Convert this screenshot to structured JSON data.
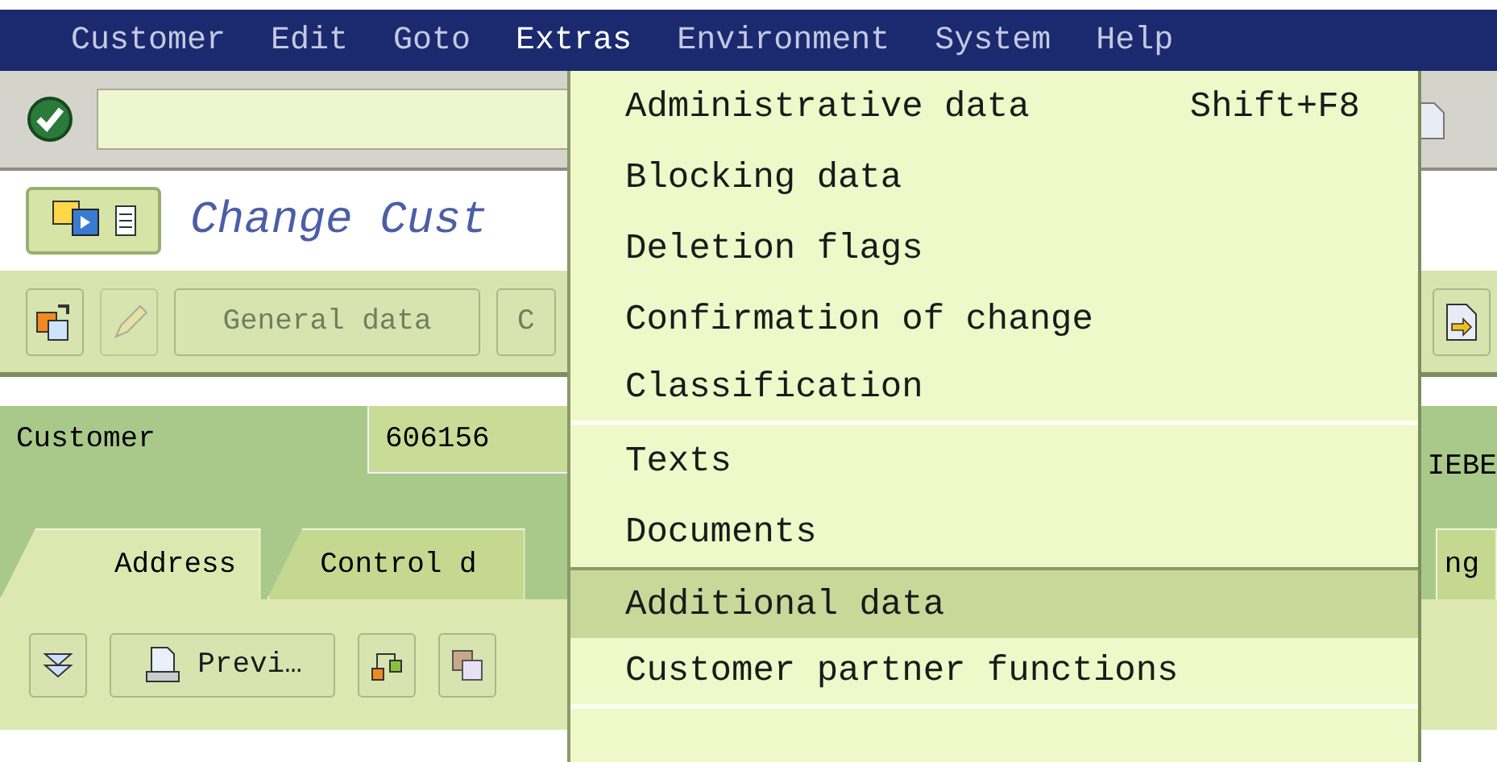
{
  "menu_bar": [
    {
      "label": "Customer",
      "selected": false
    },
    {
      "label": "Edit",
      "selected": false
    },
    {
      "label": "Goto",
      "selected": false
    },
    {
      "label": "Extras",
      "selected": true
    },
    {
      "label": "Environment",
      "selected": false
    },
    {
      "label": "System",
      "selected": false
    },
    {
      "label": "Help",
      "selected": false
    }
  ],
  "title": "Change Cust",
  "app_toolbar": {
    "buttons": [
      {
        "label": "General data",
        "disabled": true
      },
      {
        "label": "C",
        "disabled": true
      }
    ]
  },
  "header": {
    "customer_label": "Customer",
    "customer_value": "606156",
    "name_fragment": "IEBE"
  },
  "tabs": [
    {
      "label": "Address",
      "selected": true
    },
    {
      "label": "Control d",
      "selected": false
    },
    {
      "label": "ng",
      "selected": false
    }
  ],
  "tab_toolbar": {
    "preview_button": "Previ…"
  },
  "dropdown": {
    "items": [
      {
        "label": "Administrative data",
        "shortcut": "Shift+F8",
        "selected": false,
        "separator_after": false
      },
      {
        "label": "Blocking data",
        "selected": false,
        "separator_after": false
      },
      {
        "label": "Deletion flags",
        "selected": false,
        "separator_after": false
      },
      {
        "label": "Confirmation of change",
        "selected": false,
        "separator_after": false
      },
      {
        "label": "Classification",
        "selected": false,
        "separator_after": true
      },
      {
        "label": "Texts",
        "selected": false,
        "separator_after": false
      },
      {
        "label": "Documents",
        "selected": false,
        "separator_after": false
      },
      {
        "label": "Additional data",
        "selected": true,
        "separator_after": false
      },
      {
        "label": "Customer partner functions",
        "selected": false,
        "separator_after": true
      }
    ]
  }
}
